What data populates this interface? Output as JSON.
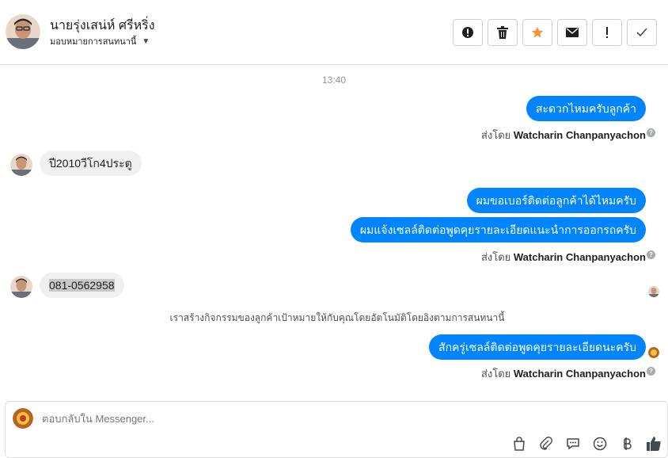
{
  "header": {
    "contact_name": "นายรุ่งเสน่ห์ ศรีหริ่ง",
    "assign_label": "มอบหมายการสนทนานี้",
    "actions": [
      {
        "icon": "alert-circle-icon"
      },
      {
        "icon": "trash-icon"
      },
      {
        "icon": "star-icon",
        "color": "#f7923b"
      },
      {
        "icon": "envelope-icon"
      },
      {
        "icon": "exclamation-icon"
      },
      {
        "icon": "check-icon"
      }
    ]
  },
  "chat": {
    "timestamp": "13:40",
    "messages": [
      {
        "from": "page",
        "text": "สะดวกไหมครับลูกค้า"
      },
      {
        "from": "customer",
        "text": "ปี2010วีโก4ประตู"
      },
      {
        "from": "page",
        "text": "ผมขอเบอร์ติดต่อลูกค้าได้ไหมครับ"
      },
      {
        "from": "page",
        "text": "ผมแจ้งเซลล์ติดต่อพูดคุยรายละเอียดแนะนำการออกรถครับ"
      },
      {
        "from": "customer",
        "text": "081-0562958"
      },
      {
        "from": "page",
        "text": "สักครู่เซลล์ติดต่อพูดคุยรายละเอียดนะครับ"
      }
    ],
    "sent_by_prefix": "ส่งโดย",
    "sent_by_name": "Watcharin Chanpanyachon",
    "system_note": "เราสร้างกิจกรรมของลูกค้าเป้าหมายให้กับคุณโดยอัตโนมัติโดยอิงตามการสนทนานี้"
  },
  "composer": {
    "placeholder": "ตอบกลับใน Messenger...",
    "tools": [
      "bag-icon",
      "paperclip-icon",
      "chat-bubble-icon",
      "smiley-icon",
      "baht-icon",
      "thumbs-up-icon"
    ]
  },
  "colors": {
    "outgoing_bubble": "#0084ff",
    "incoming_bubble": "#f1f0f0",
    "star": "#f7923b"
  }
}
